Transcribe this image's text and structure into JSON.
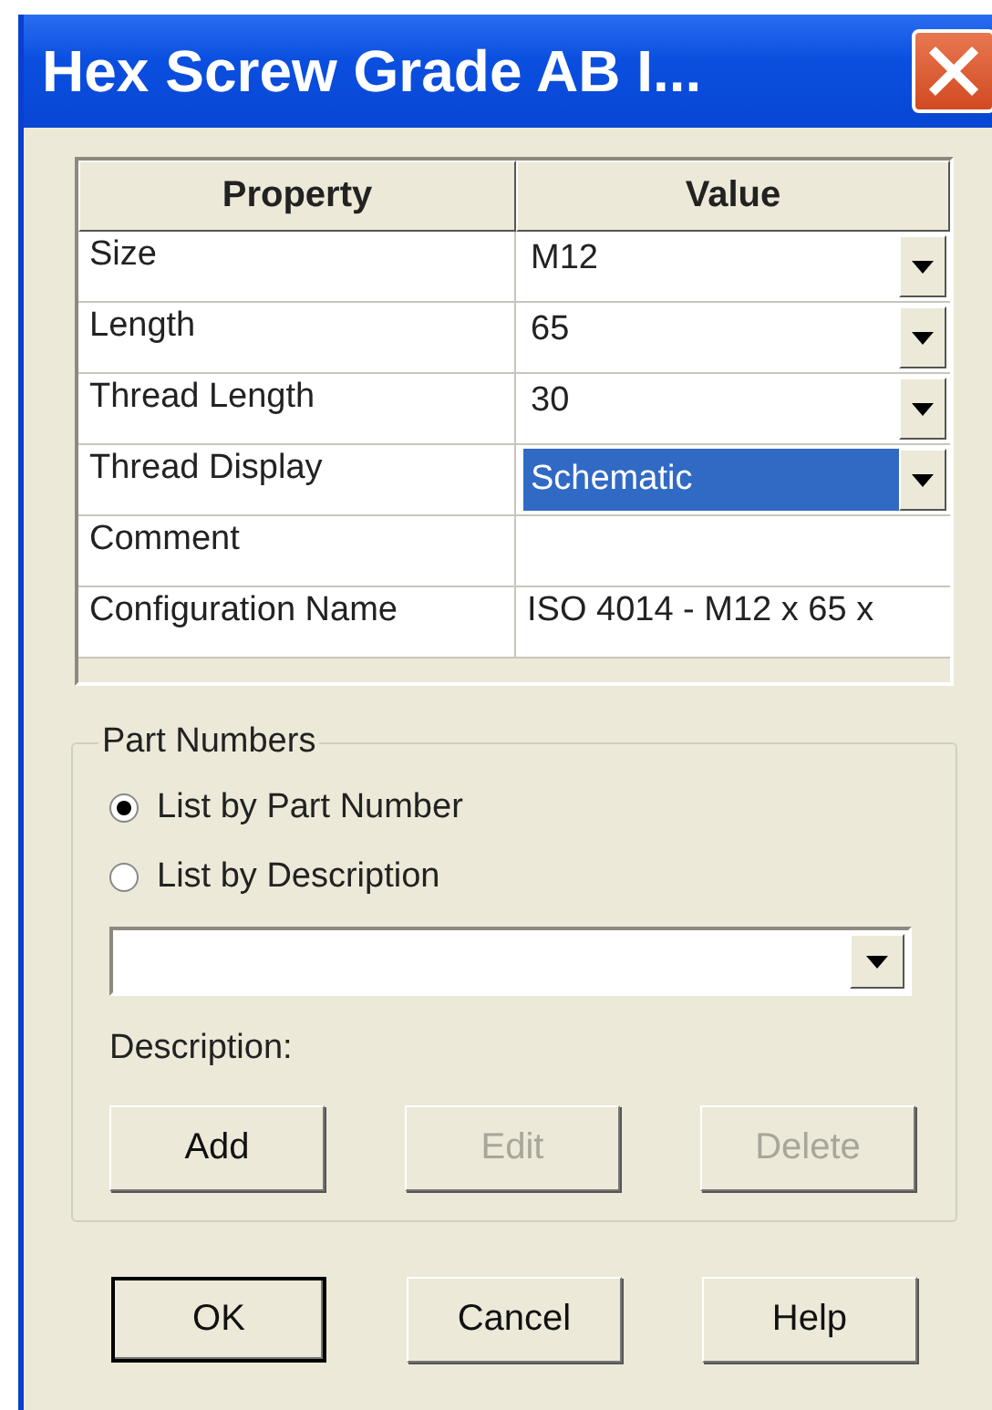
{
  "window": {
    "title": "Hex Screw Grade AB I..."
  },
  "table": {
    "columns": [
      "Property",
      "Value"
    ],
    "rows": [
      {
        "property": "Size",
        "value": "M12",
        "kind": "combo",
        "selected": false
      },
      {
        "property": "Length",
        "value": "65",
        "kind": "combo",
        "selected": false
      },
      {
        "property": "Thread Length",
        "value": "30",
        "kind": "combo",
        "selected": false
      },
      {
        "property": "Thread Display",
        "value": "Schematic",
        "kind": "combo",
        "selected": true
      },
      {
        "property": "Comment",
        "kind": "text"
      },
      {
        "property": "Configuration Name",
        "value": "ISO 4014 - M12 x 65 x",
        "kind": "text"
      }
    ]
  },
  "part_numbers": {
    "title": "Part Numbers",
    "options": [
      {
        "label": "List by Part Number",
        "selected": true
      },
      {
        "label": "List by Description",
        "selected": false
      }
    ],
    "description_label": "Description:",
    "buttons": [
      {
        "label": "Add",
        "disabled": false
      },
      {
        "label": "Edit",
        "disabled": true
      },
      {
        "label": "Delete",
        "disabled": true
      }
    ]
  },
  "buttons": [
    {
      "label": "OK",
      "default": true
    },
    {
      "label": "Cancel",
      "default": false
    },
    {
      "label": "Help",
      "default": false
    }
  ]
}
